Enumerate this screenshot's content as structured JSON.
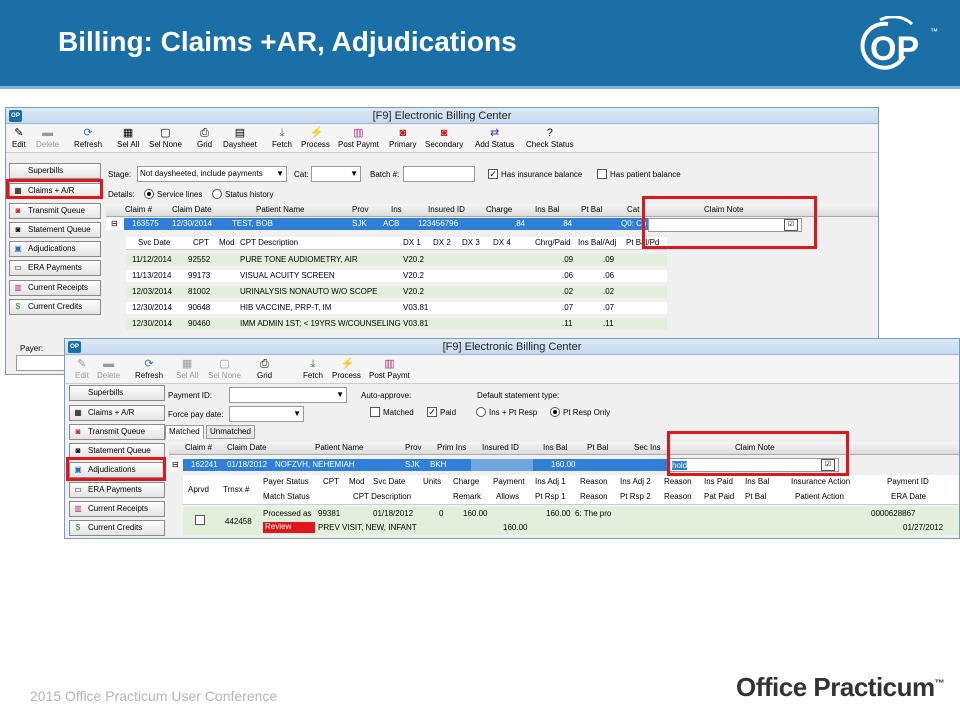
{
  "slide": {
    "title": "Billing: Claims +AR, Adjudications",
    "footer": "2015 Office Practicum User Conference",
    "brand": "Office Practicum",
    "brand_tm": "™",
    "logo_text": "OP",
    "logo_tm": "™"
  },
  "win1": {
    "title": "[F9] Electronic Billing Center",
    "toolbar": [
      "Edit",
      "Delete",
      "Refresh",
      "Sel All",
      "Sel None",
      "Grid",
      "Daysheet",
      "Fetch",
      "Process",
      "Post Paymt",
      "Primary",
      "Secondary",
      "Add Status",
      "Check Status"
    ],
    "side": [
      "Superbills",
      "Claims + A/R",
      "Transmit Queue",
      "Statement Queue",
      "Adjudications",
      "ERA Payments",
      "Current Receipts",
      "Current Credits"
    ],
    "stage_label": "Stage:",
    "stage_value": "Not daysheeted, include payments",
    "cat_label": "Cat:",
    "batch_label": "Batch #:",
    "has_ins_label": "Has insurance balance",
    "has_pat_label": "Has patient balance",
    "details_label": "Details:",
    "service_lines": "Service lines",
    "status_history": "Status history",
    "payer_label": "Payer:",
    "cols": [
      "Claim #",
      "Claim Date",
      "Patient Name",
      "Prov",
      "Ins",
      "Insured ID",
      "Charge",
      "Ins Bal",
      "Pt Bal",
      "Cat",
      "Claim Note"
    ],
    "claim": [
      "163575",
      "12/30/2014",
      "TEST, BOB",
      "SJK",
      "ACB",
      "123456796",
      ".84",
      ".84",
      "",
      "Q0: Co"
    ],
    "sub_cols": [
      "Svc Date",
      "CPT",
      "Mod",
      "CPT Description",
      "DX 1",
      "DX 2",
      "DX 3",
      "DX 4",
      "Chrg/Paid",
      "Ins Bal/Adj",
      "Pt Bal/Pd"
    ],
    "lines": [
      [
        "11/12/2014",
        "92552",
        "",
        "PURE TONE AUDIOMETRY, AIR",
        "V20.2",
        ".09",
        ".09"
      ],
      [
        "11/13/2014",
        "99173",
        "",
        "VISUAL ACUITY SCREEN",
        "V20.2",
        ".06",
        ".06"
      ],
      [
        "12/03/2014",
        "81002",
        "",
        "URINALYSIS NONAUTO W/O SCOPE",
        "V20.2",
        ".02",
        ".02"
      ],
      [
        "12/30/2014",
        "90648",
        "",
        "HIB VACCINE, PRP-T, IM",
        "V03.81",
        ".07",
        ".07"
      ],
      [
        "12/30/2014",
        "90460",
        "",
        "IMM ADMIN 1ST; < 19YRS W/COUNSELING",
        "V03.81",
        ".11",
        ".11"
      ]
    ]
  },
  "win2": {
    "title": "[F9] Electronic Billing Center",
    "toolbar": [
      "Edit",
      "Delete",
      "Refresh",
      "Sel All",
      "Sel None",
      "Grid",
      "Fetch",
      "Process",
      "Post Paymt"
    ],
    "side": [
      "Superbills",
      "Claims + A/R",
      "Transmit Queue",
      "Statement Queue",
      "Adjudications",
      "ERA Payments",
      "Current Receipts",
      "Current Credits"
    ],
    "payment_id_label": "Payment ID:",
    "force_pay_label": "Force pay date:",
    "auto_approve": "Auto-approve:",
    "matched_cb": "Matched",
    "paid_cb": "Paid",
    "default_stmt": "Default statement type:",
    "ins_pt": "Ins + Pt Resp",
    "pt_only": "Pt Resp Only",
    "tabs": [
      "Matched",
      "Unmatched"
    ],
    "cols": [
      "Claim #",
      "Claim Date",
      "Patient Name",
      "Prov",
      "Prim Ins",
      "Insured ID",
      "Ins Bal",
      "Pt Bal",
      "Sec Ins",
      "Claim Note"
    ],
    "claim": [
      "162241",
      "01/18/2012",
      "NOFZVH, NEHEMIAH",
      "SJK",
      "BKH",
      "160.00",
      "hold"
    ],
    "sub1": [
      "Aprvd",
      "Trnsx #",
      "Payer Status",
      "CPT",
      "Mod",
      "Svc Date",
      "Units",
      "Charge",
      "Payment",
      "Ins Adj 1",
      "Reason",
      "Ins Adj 2",
      "Reason",
      "Ins Paid",
      "Ins Bal",
      "Insurance Action",
      "Payment ID"
    ],
    "sub2": [
      "Match Status",
      "CPT Description",
      "Remark",
      "Allows",
      "Pt Rsp 1",
      "Reason",
      "Pt Rsp 2",
      "Reason",
      "Pat Paid",
      "Pt Bal",
      "Patient Action",
      "ERA Date"
    ],
    "r1": [
      "442458",
      "Processed as",
      "99381",
      "01/18/2012",
      "0",
      "160.00",
      "160.00",
      "6: The pro",
      "0000628867"
    ],
    "r2": [
      "Review",
      "PREV VISIT, NEW, INFANT",
      "160.00",
      "01/27/2012"
    ]
  },
  "colors": {
    "header": "#1a6fa6",
    "selected": "#2f7fd7",
    "highlight": "#e0161d",
    "green_row": "#e2efda"
  }
}
